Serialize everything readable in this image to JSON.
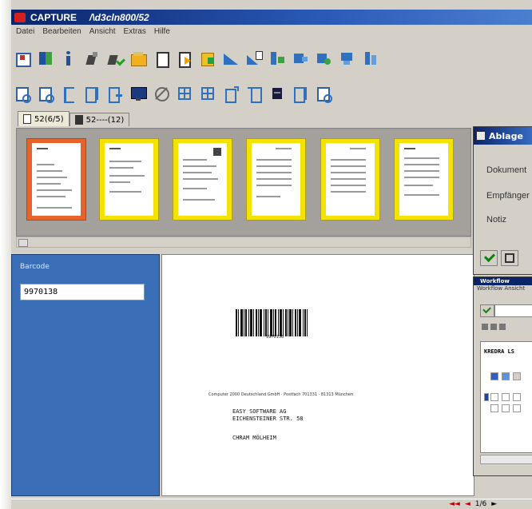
{
  "window": {
    "app_name": "CAPTURE",
    "path": "/\\d3cln800/52"
  },
  "menu": [
    "Datei",
    "Bearbeiten",
    "Ansicht",
    "Extras",
    "Hilfe"
  ],
  "toolbar1": [
    "import-icon",
    "book-icon",
    "info-icon",
    "scan-icon",
    "scan-check-icon",
    "folder-icon",
    "document-icon",
    "export-icon",
    "page-export-icon",
    "triangle-icon",
    "triangle-page-icon",
    "split-icon",
    "merge-icon",
    "rotate-icon",
    "move-down-icon",
    "move-page-icon"
  ],
  "toolbar2": [
    "zoom-in-icon",
    "zoom-out-icon",
    "list-icon",
    "list-wide-icon",
    "arrow-doc-icon",
    "monitor-icon",
    "no-entry-icon",
    "grid-icon",
    "grid-add-icon",
    "page-up-icon",
    "text-page-icon",
    "dark-page-icon",
    "columns-icon",
    "search-doc-icon"
  ],
  "tabs": [
    {
      "label": "52(6/5)"
    },
    {
      "label": "52----(12)"
    }
  ],
  "left_panel": {
    "field_label": "Barcode",
    "barcode_value": "9970138"
  },
  "document": {
    "barcode_number": "9970138",
    "sender_line": "Computer 2000 Deutschland GmbH · Postfach 701331 · 81313 München",
    "address": "EASY SOFTWARE AG\nEICHENSTEINER STR. 58",
    "contact": "CHRAM MÖLHEIM"
  },
  "ablage_dialog": {
    "title": "Ablage",
    "rows": [
      "Dokument",
      "Empfänger",
      "Notiz"
    ]
  },
  "workflow_window": {
    "title": "Workflow",
    "menu_text": "Workflow  Ansicht",
    "header_text": "KREDRA LS"
  },
  "status_bar": {
    "page_indicator": "1/6"
  },
  "colors": {
    "title_bar": "#0a246a",
    "thumb_frame": "#f4e200",
    "thumb_selected": "#e8632a",
    "left_panel": "#3a6fb8"
  }
}
